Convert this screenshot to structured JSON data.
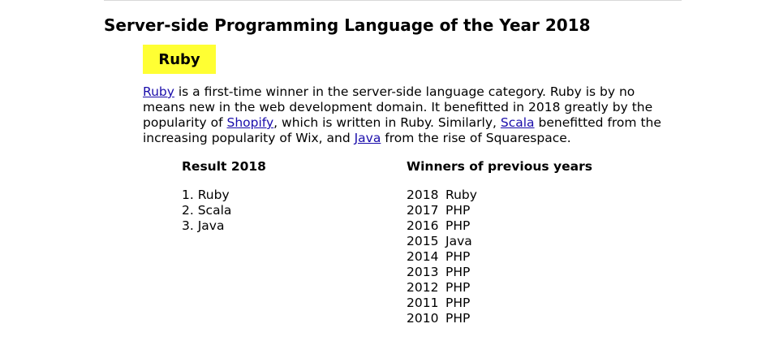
{
  "heading": "Server-side Programming Language of the Year 2018",
  "winner": "Ruby",
  "description": {
    "link_ruby": "Ruby",
    "text_1": " is a first-time winner in the server-side language category. Ruby is by no means new in the web development domain. It benefitted in 2018 greatly by the popularity of ",
    "link_shopify": "Shopify",
    "text_2": ", which is written in Ruby. Similarly, ",
    "link_scala": "Scala",
    "text_3": " benefitted from the increasing popularity of Wix, and ",
    "link_java": "Java",
    "text_4": " from the rise of Squarespace."
  },
  "result": {
    "title": "Result 2018",
    "items": [
      "1. Ruby",
      "2. Scala",
      "3. Java"
    ]
  },
  "history": {
    "title": "Winners of previous years",
    "rows": [
      {
        "year": "2018",
        "language": "Ruby"
      },
      {
        "year": "2017",
        "language": "PHP"
      },
      {
        "year": "2016",
        "language": "PHP"
      },
      {
        "year": "2015",
        "language": "Java"
      },
      {
        "year": "2014",
        "language": "PHP"
      },
      {
        "year": "2013",
        "language": "PHP"
      },
      {
        "year": "2012",
        "language": "PHP"
      },
      {
        "year": "2011",
        "language": "PHP"
      },
      {
        "year": "2010",
        "language": "PHP"
      }
    ]
  },
  "colors": {
    "highlight": "#ffff33",
    "link": "#1a0dab",
    "text": "#000000"
  }
}
